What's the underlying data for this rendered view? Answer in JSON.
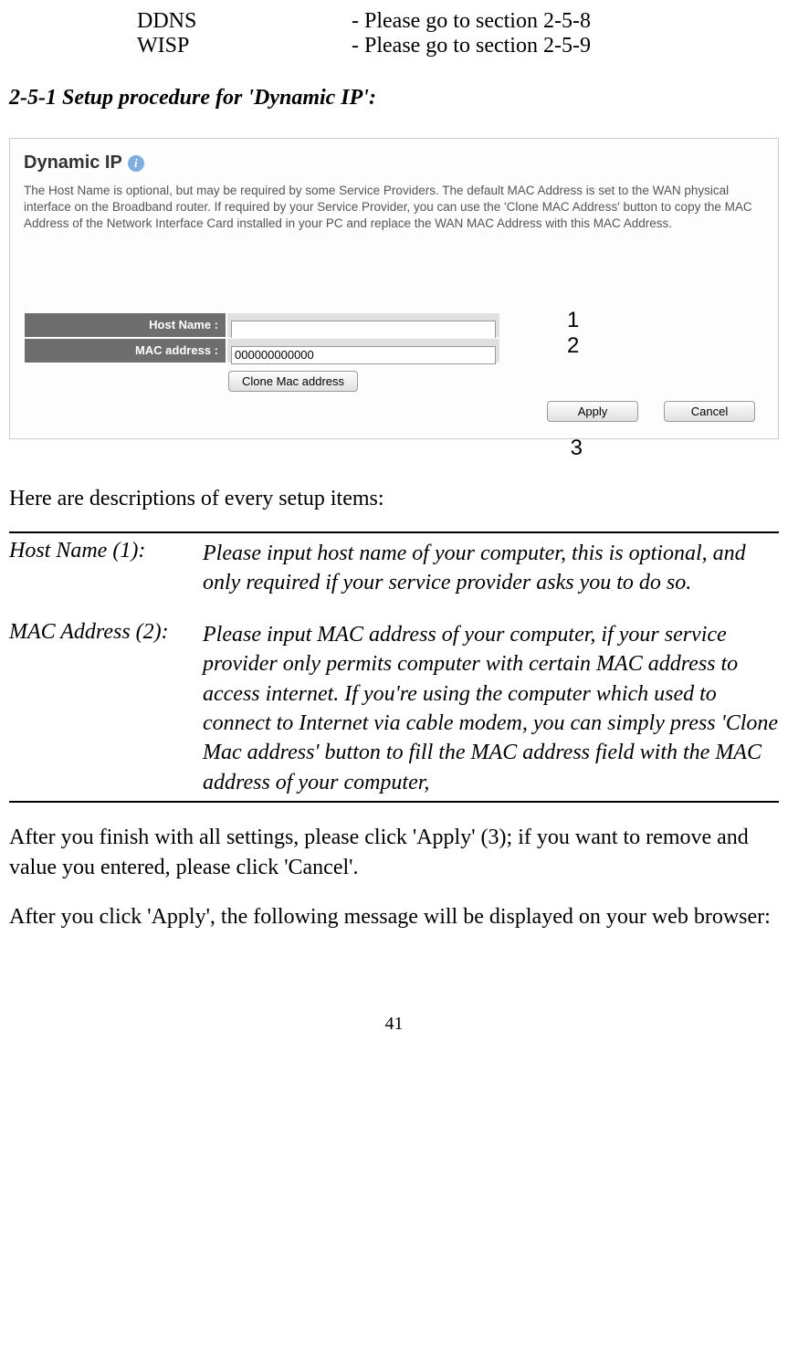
{
  "refs": [
    {
      "term": "DDNS",
      "note": "- Please go to section 2-5-8"
    },
    {
      "term": "WISP",
      "note": "- Please go to section 2-5-9"
    }
  ],
  "section_heading": "2-5-1 Setup procedure for 'Dynamic IP':",
  "screenshot": {
    "title": "Dynamic IP",
    "desc": "The Host Name is optional, but may be required by some Service Providers. The default MAC Address is set to the WAN physical interface on the Broadband router. If required by your Service Provider, you can use the 'Clone MAC Address' button to copy the MAC Address of the Network Interface Card installed in your PC and replace the WAN MAC Address with this MAC Address.",
    "host_label": "Host Name :",
    "mac_label": "MAC address :",
    "host_value": "",
    "mac_value": "000000000000",
    "clone_btn": "Clone Mac address",
    "apply_btn": "Apply",
    "cancel_btn": "Cancel"
  },
  "callouts": {
    "c1": "1",
    "c2": "2",
    "c3": "3"
  },
  "intro": "Here are descriptions of every setup items:",
  "definitions": [
    {
      "term": "Host Name (1):",
      "text": "Please input host name of your computer, this is optional, and only required if your service provider asks you to do so."
    },
    {
      "term": "MAC Address (2):",
      "text": "Please input MAC address of your computer, if your service provider only permits computer with certain MAC address to access internet. If you're using the computer which used to connect to Internet via cable modem, you can simply press 'Clone Mac address' button to fill the MAC address field with the MAC address of your computer,"
    }
  ],
  "para1": "After you finish with all settings, please click 'Apply' (3); if you want to remove and value you entered, please click 'Cancel'.",
  "para2": "After you click 'Apply', the following message will be displayed on your web browser:",
  "page_number": "41"
}
